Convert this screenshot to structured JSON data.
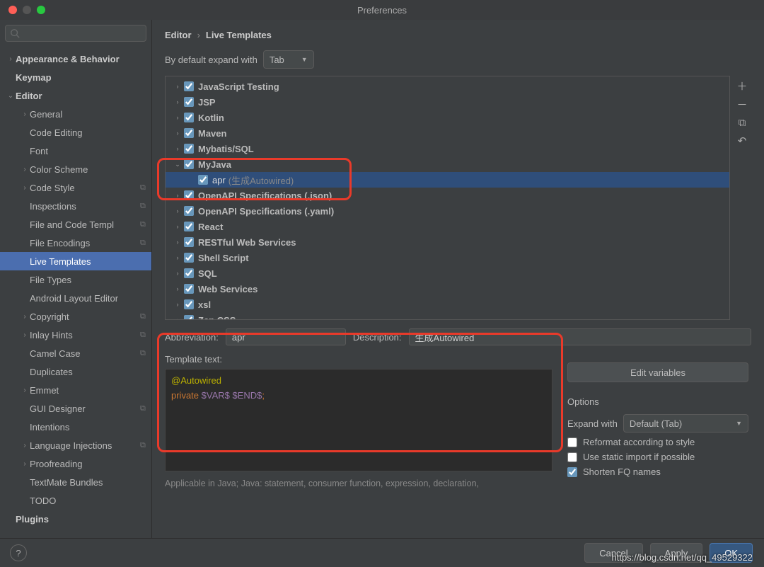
{
  "window": {
    "title": "Preferences"
  },
  "breadcrumb": {
    "a": "Editor",
    "b": "Live Templates"
  },
  "expand": {
    "label": "By default expand with",
    "value": "Tab"
  },
  "sidebar": [
    {
      "label": "Appearance & Behavior",
      "indent": 0,
      "arrow": "›",
      "bold": true
    },
    {
      "label": "Keymap",
      "indent": 0,
      "arrow": "",
      "bold": true
    },
    {
      "label": "Editor",
      "indent": 0,
      "arrow": "⌄",
      "bold": true
    },
    {
      "label": "General",
      "indent": 1,
      "arrow": "›"
    },
    {
      "label": "Code Editing",
      "indent": 1,
      "arrow": ""
    },
    {
      "label": "Font",
      "indent": 1,
      "arrow": ""
    },
    {
      "label": "Color Scheme",
      "indent": 1,
      "arrow": "›"
    },
    {
      "label": "Code Style",
      "indent": 1,
      "arrow": "›",
      "copy": true
    },
    {
      "label": "Inspections",
      "indent": 1,
      "arrow": "",
      "copy": true
    },
    {
      "label": "File and Code Templ",
      "indent": 1,
      "arrow": "",
      "copy": true
    },
    {
      "label": "File Encodings",
      "indent": 1,
      "arrow": "",
      "copy": true
    },
    {
      "label": "Live Templates",
      "indent": 1,
      "arrow": "",
      "selected": true
    },
    {
      "label": "File Types",
      "indent": 1,
      "arrow": ""
    },
    {
      "label": "Android Layout Editor",
      "indent": 1,
      "arrow": ""
    },
    {
      "label": "Copyright",
      "indent": 1,
      "arrow": "›",
      "copy": true
    },
    {
      "label": "Inlay Hints",
      "indent": 1,
      "arrow": "›",
      "copy": true
    },
    {
      "label": "Camel Case",
      "indent": 1,
      "arrow": "",
      "copy": true
    },
    {
      "label": "Duplicates",
      "indent": 1,
      "arrow": ""
    },
    {
      "label": "Emmet",
      "indent": 1,
      "arrow": "›"
    },
    {
      "label": "GUI Designer",
      "indent": 1,
      "arrow": "",
      "copy": true
    },
    {
      "label": "Intentions",
      "indent": 1,
      "arrow": ""
    },
    {
      "label": "Language Injections",
      "indent": 1,
      "arrow": "›",
      "copy": true
    },
    {
      "label": "Proofreading",
      "indent": 1,
      "arrow": "›"
    },
    {
      "label": "TextMate Bundles",
      "indent": 1,
      "arrow": ""
    },
    {
      "label": "TODO",
      "indent": 1,
      "arrow": ""
    },
    {
      "label": "Plugins",
      "indent": 0,
      "arrow": "",
      "bold": true
    }
  ],
  "templates": [
    {
      "label": "JavaScript Testing",
      "arrow": "›",
      "indent": 0
    },
    {
      "label": "JSP",
      "arrow": "›",
      "indent": 0
    },
    {
      "label": "Kotlin",
      "arrow": "›",
      "indent": 0
    },
    {
      "label": "Maven",
      "arrow": "›",
      "indent": 0
    },
    {
      "label": "Mybatis/SQL",
      "arrow": "›",
      "indent": 0
    },
    {
      "label": "MyJava",
      "arrow": "⌄",
      "indent": 0
    },
    {
      "label": "apr",
      "desc": "(生成Autowired)",
      "arrow": "",
      "indent": 1,
      "child": true
    },
    {
      "label": "OpenAPI Specifications (.json)",
      "arrow": "›",
      "indent": 0
    },
    {
      "label": "OpenAPI Specifications (.yaml)",
      "arrow": "›",
      "indent": 0
    },
    {
      "label": "React",
      "arrow": "›",
      "indent": 0
    },
    {
      "label": "RESTful Web Services",
      "arrow": "›",
      "indent": 0
    },
    {
      "label": "Shell Script",
      "arrow": "›",
      "indent": 0
    },
    {
      "label": "SQL",
      "arrow": "›",
      "indent": 0
    },
    {
      "label": "Web Services",
      "arrow": "›",
      "indent": 0
    },
    {
      "label": "xsl",
      "arrow": "›",
      "indent": 0
    },
    {
      "label": "Zen CSS",
      "arrow": "›",
      "indent": 0
    }
  ],
  "form": {
    "abbrLabel": "Abbreviation:",
    "abbr": "apr",
    "descLabel": "Description:",
    "desc": "生成Autowired",
    "templateTextLabel": "Template text:",
    "code": {
      "l1": "@Autowired",
      "l2a": "private",
      "l2b": " $VAR$ $END$",
      "l2c": ";"
    },
    "editVars": "Edit variables",
    "optionsHdr": "Options",
    "expandLabel": "Expand with",
    "expandVal": "Default (Tab)",
    "opt1": "Reformat according to style",
    "opt2": "Use static import if possible",
    "opt3": "Shorten FQ names",
    "applicable": "Applicable in Java; Java: statement, consumer function, expression, declaration,"
  },
  "footer": {
    "cancel": "Cancel",
    "apply": "Apply",
    "ok": "OK"
  },
  "watermark": "https://blog.csdn.net/qq_49529322"
}
